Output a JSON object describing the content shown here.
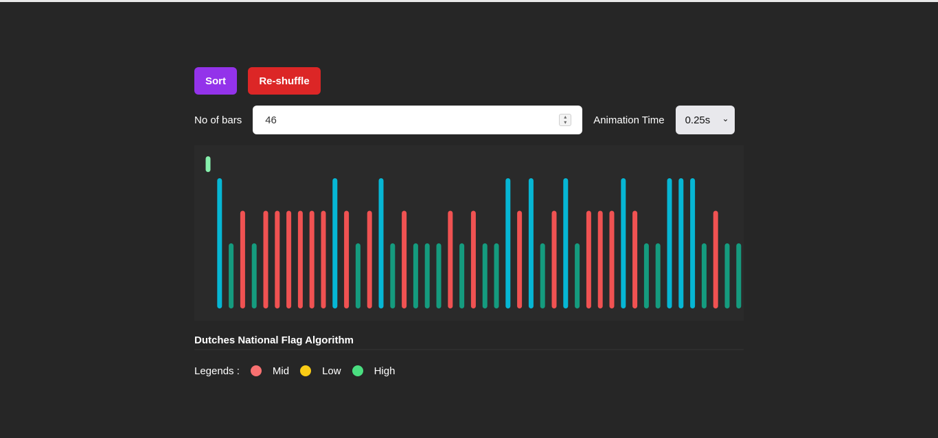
{
  "buttons": {
    "sort_label": "Sort",
    "shuffle_label": "Re-shuffle"
  },
  "controls": {
    "bars_label": "No of bars",
    "bars_value": "46",
    "animation_label": "Animation Time",
    "animation_value": "0.25s"
  },
  "chart_data": {
    "type": "bar",
    "values": [
      0.2,
      4,
      2,
      3,
      2,
      3,
      3,
      3,
      3,
      3,
      3,
      4,
      3,
      2,
      3,
      4,
      2,
      3,
      2,
      2,
      2,
      3,
      2,
      3,
      2,
      2,
      4,
      3,
      4,
      2,
      3,
      4,
      2,
      3,
      3,
      3,
      4,
      3,
      2,
      2,
      4,
      4,
      4,
      2,
      3,
      2,
      2
    ],
    "categories": [
      "mark",
      "high",
      "low",
      "mid",
      "low",
      "mid",
      "mid",
      "mid",
      "mid",
      "mid",
      "mid",
      "high",
      "mid",
      "low",
      "mid",
      "high",
      "low",
      "mid",
      "low",
      "low",
      "low",
      "mid",
      "low",
      "mid",
      "low",
      "low",
      "high",
      "mid",
      "high",
      "low",
      "mid",
      "high",
      "low",
      "mid",
      "mid",
      "mid",
      "high",
      "mid",
      "low",
      "low",
      "high",
      "high",
      "high",
      "low",
      "mid",
      "low",
      "low"
    ],
    "colors": {
      "mark": "#86efac",
      "high": "#06b6d4",
      "mid": "#f05252",
      "low": "#159b7e"
    }
  },
  "info": {
    "algorithm_title": "Dutches National Flag Algorithm",
    "legends_label": "Legends :",
    "legend_items": [
      {
        "label": "Mid",
        "color": "#f87171"
      },
      {
        "label": "Low",
        "color": "#facc15"
      },
      {
        "label": "High",
        "color": "#4ade80"
      }
    ]
  }
}
